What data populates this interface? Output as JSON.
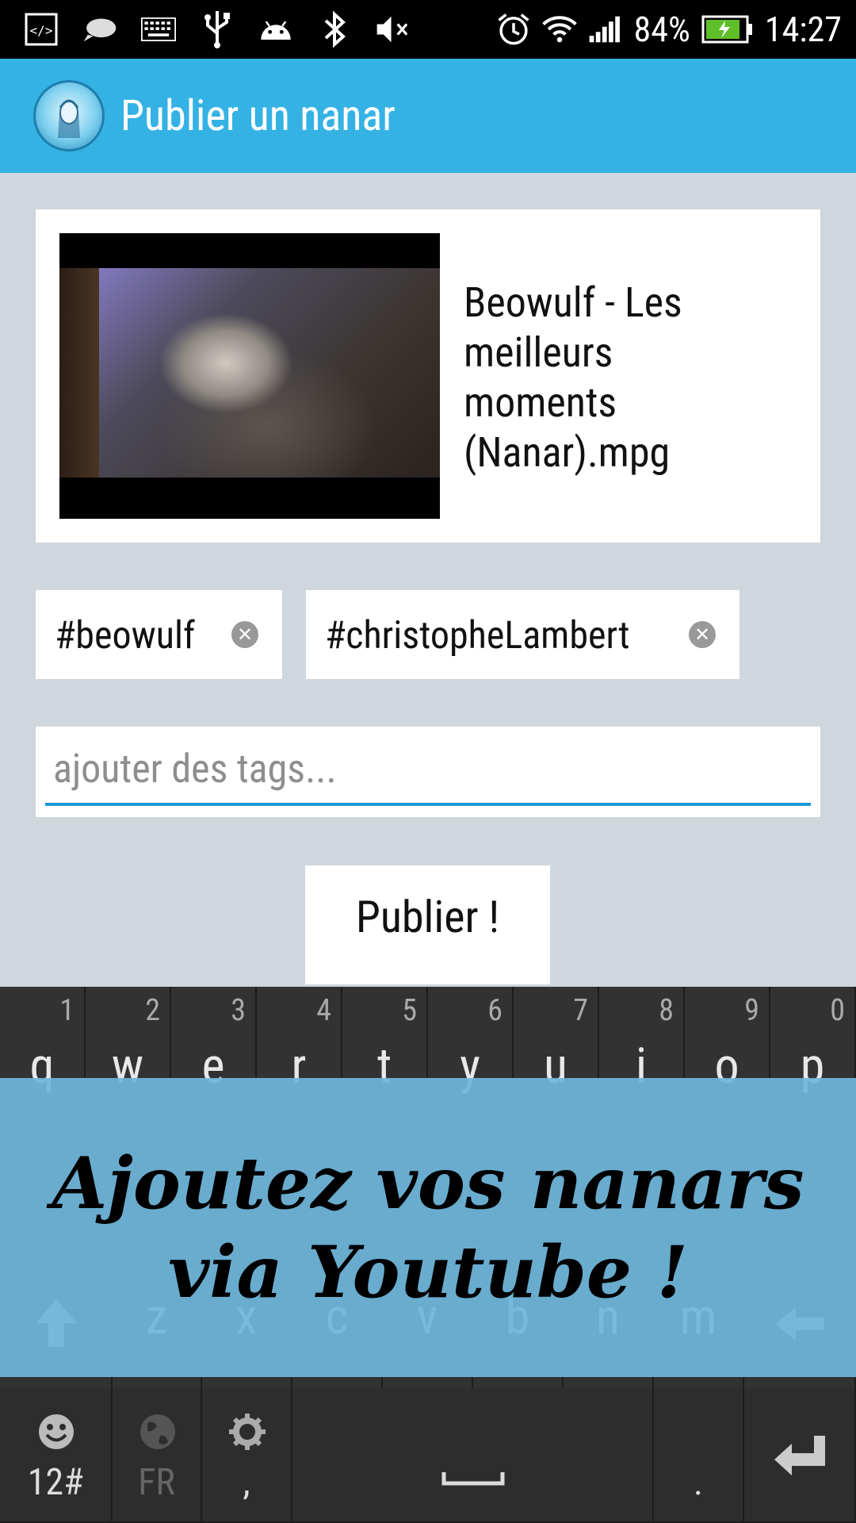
{
  "status_bar": {
    "battery": "84%",
    "time": "14:27",
    "icons": [
      "dev-icon",
      "chat-icon",
      "keyboard-icon",
      "usb-icon",
      "android-icon",
      "bluetooth-icon",
      "mute-icon",
      "alarm-icon",
      "wifi-icon",
      "signal-icon",
      "battery-icon"
    ]
  },
  "action_bar": {
    "title": "Publier un nanar"
  },
  "video": {
    "title": "Beowulf - Les\nmeilleurs\nmoments\n(Nanar).mpg"
  },
  "tags": [
    {
      "label": "#beowulf"
    },
    {
      "label": "#christopheLambert"
    }
  ],
  "tag_input": {
    "placeholder": "ajouter des tags..."
  },
  "publish_button": {
    "label": "Publier !"
  },
  "keyboard": {
    "row1": [
      {
        "letter": "q",
        "hint": "1"
      },
      {
        "letter": "w",
        "hint": "2"
      },
      {
        "letter": "e",
        "hint": "3"
      },
      {
        "letter": "r",
        "hint": "4"
      },
      {
        "letter": "t",
        "hint": "5"
      },
      {
        "letter": "y",
        "hint": "6"
      },
      {
        "letter": "u",
        "hint": "7"
      },
      {
        "letter": "i",
        "hint": "8"
      },
      {
        "letter": "o",
        "hint": "9"
      },
      {
        "letter": "p",
        "hint": "0"
      }
    ],
    "row3": [
      "z",
      "x",
      "c",
      "v",
      "b",
      "n",
      "m"
    ],
    "bottom": {
      "numbers": "12#",
      "lang": "FR",
      "comma": ",",
      "period": "."
    }
  },
  "overlay": {
    "text": "Ajoutez vos nanars\nvia Youtube !"
  },
  "colors": {
    "action_bar": "#35b2e4",
    "background": "#cfd6dd",
    "input_underline": "#1c9ad3",
    "overlay": "#6eb6da"
  }
}
